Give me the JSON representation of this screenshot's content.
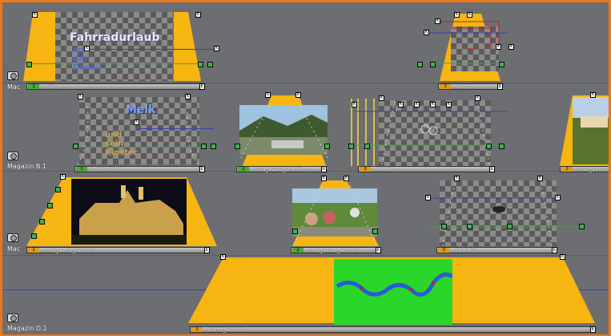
{
  "app": {
    "accent_border": "#e9781c",
    "clip_fill": "#f7b512"
  },
  "lanes": [
    {
      "label": "Mac",
      "camera_icon": "camera-icon"
    },
    {
      "label": "Magazin B.1",
      "camera_icon": "camera-icon"
    },
    {
      "label": "Mac",
      "camera_icon": "camera-icon"
    },
    {
      "label": "Magazin D.1",
      "camera_icon": "camera-icon"
    }
  ],
  "clips": {
    "title_fahrradurlaub": {
      "line1": "Fahrradurlaub",
      "line2": "an der Donau",
      "bar_label": "Titel",
      "bar_num": "1"
    },
    "clip_zoom": {
      "bar_label": "Zoom",
      "bar_num": "3"
    },
    "title_melk": {
      "line1": "Melk",
      "line2": "und sein Kloster",
      "bar_label": "Titel Melk",
      "bar_num": "1"
    },
    "photo_1226": {
      "bar_label": "IMG_1226_Wiesel",
      "bar_num": "2"
    },
    "clip_rader": {
      "bar_label": "Räder",
      "bar_num": "3"
    },
    "photo_1665": {
      "bar_label": "IMG_1665",
      "bar_num": "3"
    },
    "photo_1765": {
      "bar_label": "IMG_1765_Wiesel",
      "bar_num": "1"
    },
    "photo_1616": {
      "bar_label": "IMG_1616_Wiesel",
      "bar_num": "2"
    },
    "clip_ebike": {
      "bar_label": "EbiKlein",
      "bar_num": "3"
    },
    "map_karte": {
      "bar_label": "Karte_Wiesel",
      "bar_num": "1"
    }
  }
}
